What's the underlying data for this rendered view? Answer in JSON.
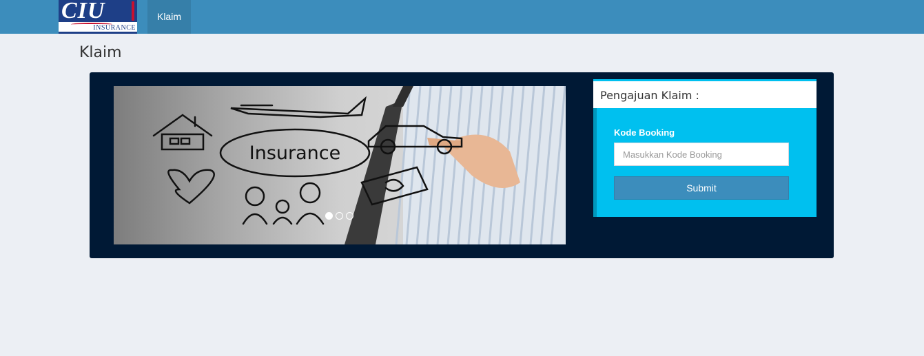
{
  "navbar": {
    "logo": {
      "main_text": "CIU",
      "sub_text": "INSURANCE"
    },
    "tabs": [
      {
        "label": "Klaim",
        "active": true
      }
    ]
  },
  "page": {
    "title": "Klaim"
  },
  "carousel": {
    "slide_caption": "Insurance",
    "indicators": [
      {
        "active": true
      },
      {
        "active": false
      },
      {
        "active": false
      }
    ]
  },
  "claim_form": {
    "title": "Pengajuan Klaim :",
    "booking_label": "Kode Booking",
    "booking_placeholder": "Masukkan Kode Booking",
    "booking_value": "",
    "submit_label": "Submit"
  },
  "colors": {
    "navbar": "#3c8dbc",
    "active_tab": "#367fa9",
    "panel": "#001935",
    "form_accent": "#00c0ef",
    "page_background": "#eceff4"
  }
}
